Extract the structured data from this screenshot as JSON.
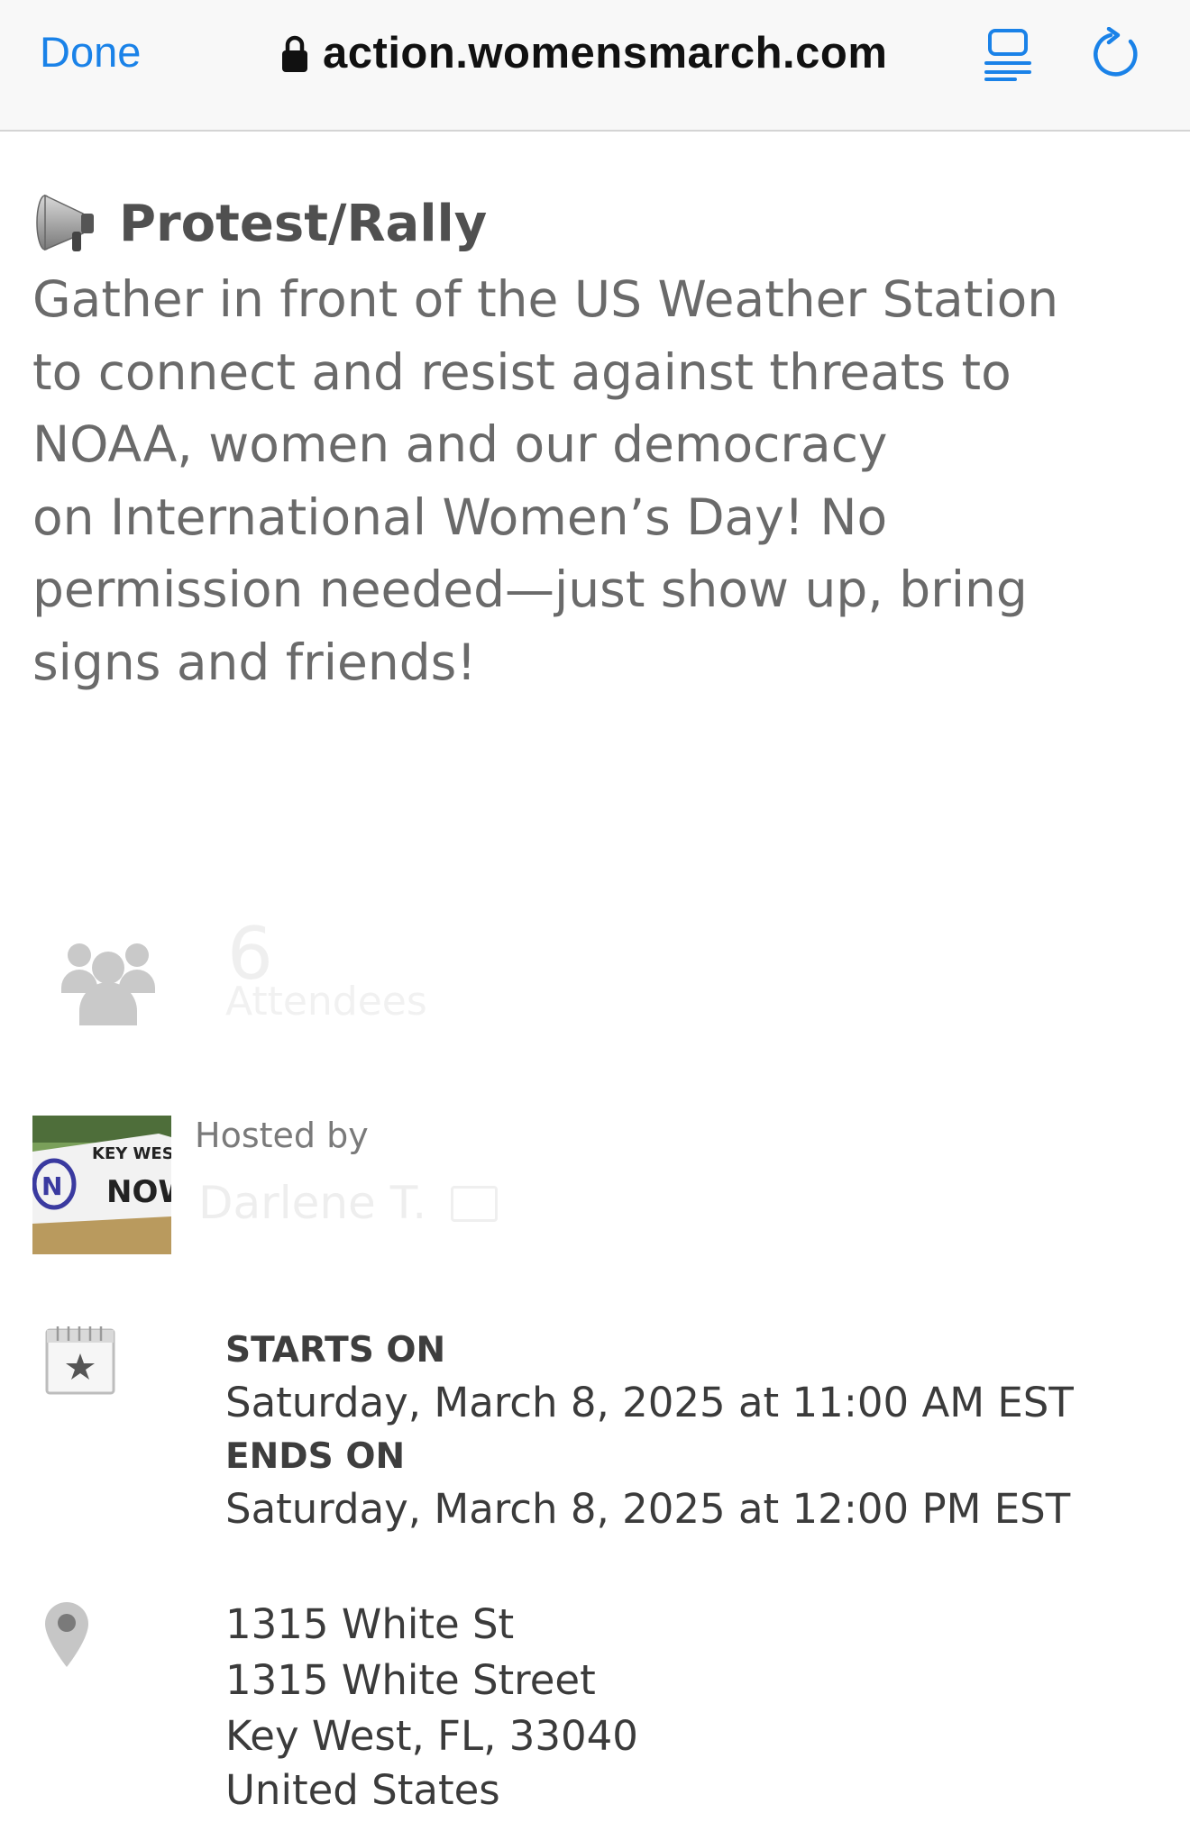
{
  "browser": {
    "done_label": "Done",
    "url": "action.womensmarch.com",
    "lock_icon": "lock-icon",
    "reader_icon": "reader-mode-icon",
    "reload_icon": "reload-icon",
    "accent": "#1a82e8"
  },
  "event": {
    "type_icon": "megaphone-icon",
    "type": "Protest/Rally",
    "description": "Gather in front of the US Weather Station\nto connect and resist against threats to\nNOAA, women and our democracy\non International Women’s Day!  No\npermission needed—just show up, bring\nsigns and friends!"
  },
  "attendees": {
    "icon": "people-icon",
    "count": "6",
    "label": "Attendees"
  },
  "host": {
    "image_alt": "KEY WEST NOW",
    "hosted_by_label": "Hosted by",
    "name": "Darlene T."
  },
  "schedule": {
    "icon": "calendar-icon",
    "starts_label": "STARTS ON",
    "starts_value": "Saturday, March 8, 2025 at 11:00 AM EST",
    "ends_label": "ENDS ON",
    "ends_value": "Saturday, March 8, 2025 at 12:00 PM EST"
  },
  "location": {
    "icon": "map-pin-icon",
    "lines": [
      "1315 White St",
      "1315 White Street",
      "Key West, FL, 33040",
      "United States"
    ]
  }
}
